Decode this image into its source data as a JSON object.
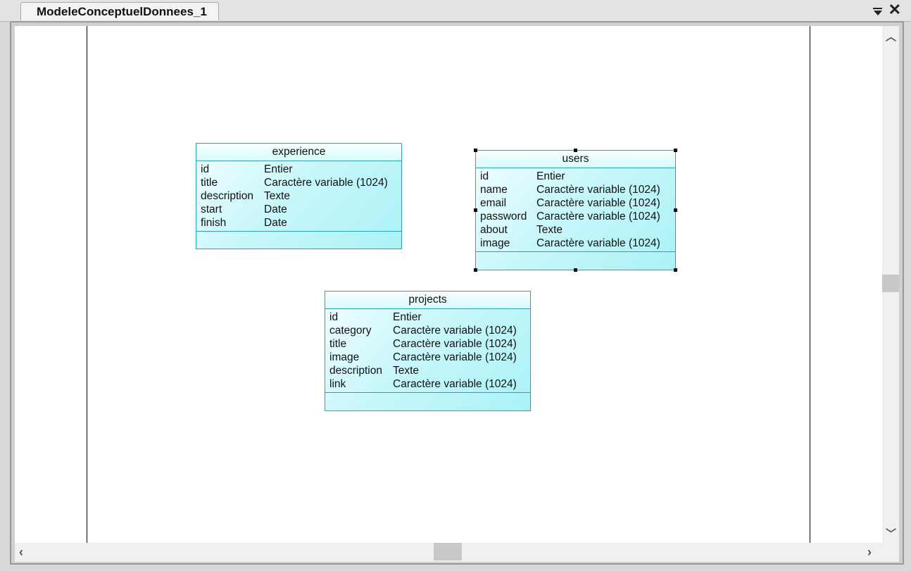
{
  "tab": {
    "title": "ModeleConceptuelDonnees_1"
  },
  "icons": {
    "menu": "dropdown-menu-icon",
    "close": "close-icon",
    "scroll_up": "chevron-up-icon",
    "scroll_down": "chevron-down-icon",
    "scroll_left": "chevron-left-icon",
    "scroll_right": "chevron-right-icon"
  },
  "colors": {
    "entity_border": "#2aa4b0",
    "entity_fill": "#b8f4f8",
    "canvas": "#ffffff"
  },
  "entities": {
    "experience": {
      "name": "experience",
      "attributes": [
        {
          "name": "id",
          "type": "Entier"
        },
        {
          "name": "title",
          "type": "Caractère variable (1024)"
        },
        {
          "name": "description",
          "type": "Texte"
        },
        {
          "name": "start",
          "type": "Date"
        },
        {
          "name": "finish",
          "type": "Date"
        }
      ]
    },
    "users": {
      "name": "users",
      "selected": true,
      "attributes": [
        {
          "name": "id",
          "type": "Entier"
        },
        {
          "name": "name",
          "type": "Caractère variable (1024)"
        },
        {
          "name": "email",
          "type": "Caractère variable (1024)"
        },
        {
          "name": "password",
          "type": "Caractère variable (1024)"
        },
        {
          "name": "about",
          "type": "Texte"
        },
        {
          "name": "image",
          "type": "Caractère variable (1024)"
        }
      ]
    },
    "projects": {
      "name": "projects",
      "attributes": [
        {
          "name": "id",
          "type": "Entier"
        },
        {
          "name": "category",
          "type": "Caractère variable (1024)"
        },
        {
          "name": "title",
          "type": "Caractère variable (1024)"
        },
        {
          "name": "image",
          "type": "Caractère variable (1024)"
        },
        {
          "name": "description",
          "type": "Texte"
        },
        {
          "name": "link",
          "type": "Caractère variable (1024)"
        }
      ]
    }
  }
}
